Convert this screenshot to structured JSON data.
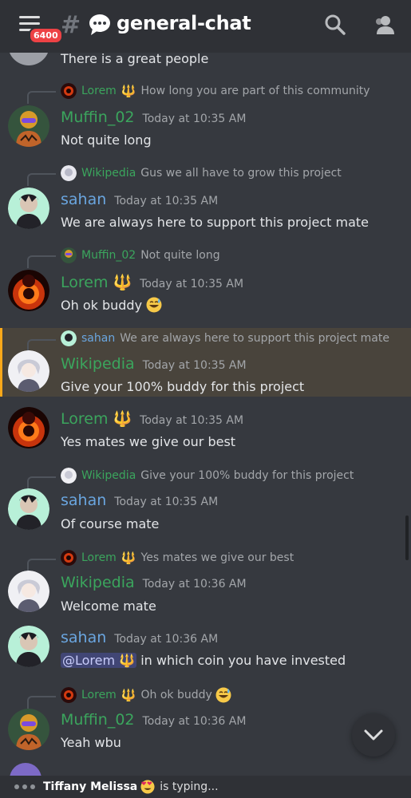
{
  "header": {
    "notification_count": "6400",
    "hash": "#",
    "channel_name": "general-chat",
    "icons": [
      "menu-icon",
      "speech-balloon-icon",
      "search-icon",
      "members-icon"
    ]
  },
  "colors": {
    "background": "#36393f",
    "header": "#2f3136",
    "username_green": "#3ba55d",
    "username_blue": "#6aa6e0",
    "highlight_bg": "#49443c",
    "highlight_border": "#faa81a"
  },
  "messages": [
    {
      "text": "There is a great people"
    },
    {
      "reply_author": "Lorem",
      "reply_trident": "🔱",
      "reply_text": "How long you are part of this community",
      "author": "Muffin_02",
      "timestamp": "Today at 10:35 AM",
      "text": "Not quite long"
    },
    {
      "reply_author": "Wikipedia",
      "reply_text": "Gus we all have to grow this project",
      "author": "sahan",
      "timestamp": "Today at 10:35 AM",
      "text": "We are always here to support this project mate"
    },
    {
      "reply_author": "Muffin_02",
      "reply_text": "Not quite long",
      "author": "Lorem",
      "trident": "🔱",
      "timestamp": "Today at 10:35 AM",
      "text": "Oh ok buddy"
    },
    {
      "reply_author": "sahan",
      "reply_text": "We are always here to support this project mate",
      "author": "Wikipedia",
      "timestamp": "Today at 10:35 AM",
      "text": "Give your 100% buddy for this project"
    },
    {
      "author": "Lorem",
      "trident": "🔱",
      "timestamp": "Today at 10:35 AM",
      "text": "Yes mates we give our best"
    },
    {
      "reply_author": "Wikipedia",
      "reply_text": "Give your 100% buddy for this project",
      "author": "sahan",
      "timestamp": "Today at 10:35 AM",
      "text": "Of course mate"
    },
    {
      "reply_author": "Lorem",
      "reply_trident": "🔱",
      "reply_text": "Yes mates we give our best",
      "author": "Wikipedia",
      "timestamp": "Today at 10:36 AM",
      "text": "Welcome  mate"
    },
    {
      "author": "sahan",
      "timestamp": "Today at 10:36 AM",
      "mention": "@Lorem 🔱",
      "text": "in which coin you have invested"
    },
    {
      "reply_author": "Lorem",
      "reply_trident": "🔱",
      "reply_text": "Oh ok buddy",
      "author": "Muffin_02",
      "timestamp": "Today at 10:36 AM",
      "text": "Yeah wbu"
    }
  ],
  "typing": {
    "user": "Tiffany Melissa",
    "suffix": "is typing..."
  }
}
